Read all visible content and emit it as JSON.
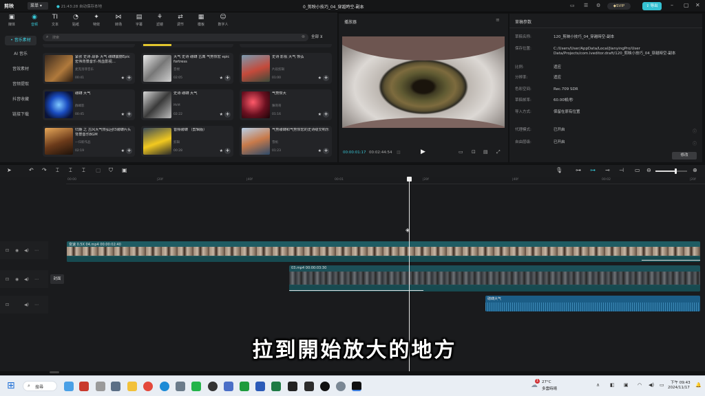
{
  "app": {
    "logo": "剪映",
    "menu": "菜单",
    "autosave": "21:43:28 自动保存本地",
    "title": "0_剪映小技巧_04_穿越時空-副本",
    "vip": "SVIP",
    "publish": "导出"
  },
  "toolbar": [
    "媒体",
    "音频",
    "文本",
    "贴纸",
    "特效",
    "转场",
    "字幕",
    "滤镜",
    "调节",
    "模板",
    "数字人"
  ],
  "leftnav": [
    "• 音乐素材",
    "AI 音乐",
    "音效素材",
    "音频提取",
    "抖音收藏",
    "链接下载"
  ],
  "search": {
    "placeholder": "搜索",
    "filter": "全部"
  },
  "cards": [
    {
      "title": "紧张 史诗 战争 大气 磅礴震撼Epic宏伟背景音乐-热血影视…",
      "author": "麦克洛菲音乐",
      "dur": "00:41"
    },
    {
      "title": "大气 史诗 磅礴 古典 气势恢宏 epic fortress",
      "author": "音視",
      "dur": "02:05"
    },
    {
      "title": "史诗 影视 大气 恢弘",
      "author": "片段剪辑",
      "dur": "01:00"
    },
    {
      "title": "磅礴 大气",
      "author": "群峰影",
      "dur": "00:45"
    },
    {
      "title": "史诗 磅礴 大气",
      "author": "MrM",
      "dur": "02:22"
    },
    {
      "title": "气势恢大",
      "author": "陳哥哥",
      "dur": "01:16"
    },
    {
      "title": "归期 之 古风大气恢弘回归磅礴片头背景音乐BGM",
      "author": "一归新作品",
      "dur": "02:19"
    },
    {
      "title": "音频磅礴 （剪辑版）",
      "author": "剪辑",
      "dur": "00:28"
    },
    {
      "title": "气势磅礴和气势恢宏的史诗级交响乐",
      "author": "雪帆",
      "dur": "01:23"
    }
  ],
  "player": {
    "label": "播放器",
    "current": "00:00:01:17",
    "total": "00:02:44:54"
  },
  "props": {
    "label": "草稿参数",
    "rows": [
      {
        "k": "草稿名称:",
        "v": "120_剪映小技巧_04_穿越時空-副本"
      },
      {
        "k": "保存位置:",
        "v": "C:/Users/User/AppData/Local/JianyingPro/User Data/Projects/com.lveditor.draft/120_剪映小技巧_04_穿越時空-副本"
      },
      {
        "k": "比例:",
        "v": "适应"
      },
      {
        "k": "分辨率:",
        "v": "适应"
      },
      {
        "k": "色彩空间:",
        "v": "Rec.709 SDR"
      },
      {
        "k": "草稿帧率:",
        "v": "60.00帧/秒"
      },
      {
        "k": "导入方式:",
        "v": "保留在原有位置"
      },
      {
        "k": "代理模式:",
        "v": "已开启"
      },
      {
        "k": "自由层级:",
        "v": "已开启"
      }
    ],
    "modify": "修改"
  },
  "ruler": [
    "00:00",
    "|20f",
    "|40f",
    "00:01",
    "|20f",
    "|40f",
    "00:02",
    "|20f"
  ],
  "tracks": {
    "clip1": "变速 0.5X  04.mp4  00:00:02:40",
    "clip2": "03.mp4  00:00:03:30",
    "cover": "封面",
    "audio": "磅礴大气"
  },
  "subtitle": "拉到開始放大的地方",
  "taskbar": {
    "search": "搜尋",
    "weather_temp": "27°C",
    "weather_desc": "多雲時晴",
    "time": "下午 09:43",
    "date": "2024/11/17",
    "badge": "1"
  },
  "colors": {
    "accent": "#38c9d8",
    "video_track": "#1f5c63",
    "audio_track": "#1b5d86"
  }
}
